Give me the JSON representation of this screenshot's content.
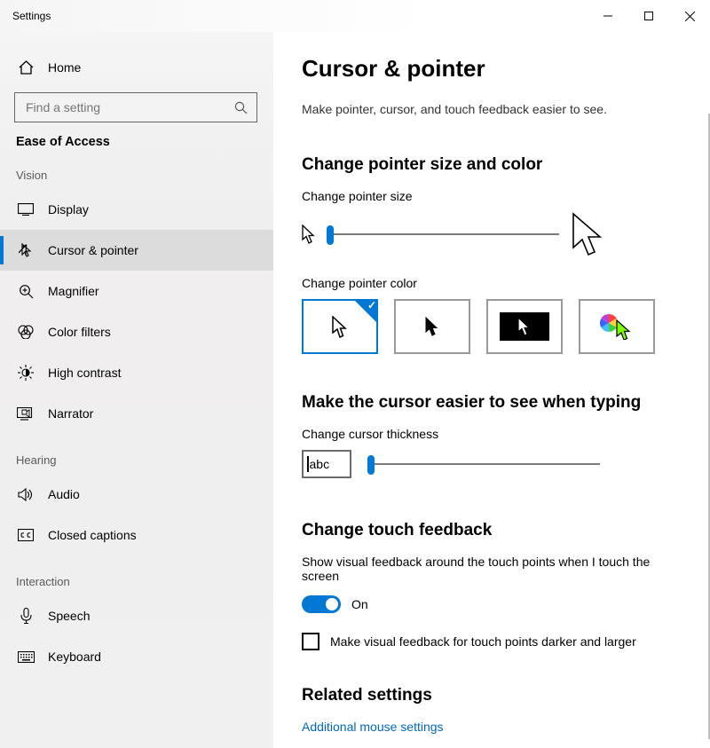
{
  "window": {
    "title": "Settings"
  },
  "sidebar": {
    "home": "Home",
    "search_placeholder": "Find a setting",
    "section": "Ease of Access",
    "groups": [
      {
        "label": "Vision",
        "items": [
          {
            "id": "display",
            "label": "Display"
          },
          {
            "id": "cursor-pointer",
            "label": "Cursor & pointer",
            "selected": true
          },
          {
            "id": "magnifier",
            "label": "Magnifier"
          },
          {
            "id": "color-filters",
            "label": "Color filters"
          },
          {
            "id": "high-contrast",
            "label": "High contrast"
          },
          {
            "id": "narrator",
            "label": "Narrator"
          }
        ]
      },
      {
        "label": "Hearing",
        "items": [
          {
            "id": "audio",
            "label": "Audio"
          },
          {
            "id": "closed-captions",
            "label": "Closed captions"
          }
        ]
      },
      {
        "label": "Interaction",
        "items": [
          {
            "id": "speech",
            "label": "Speech"
          },
          {
            "id": "keyboard",
            "label": "Keyboard"
          }
        ]
      }
    ]
  },
  "page": {
    "title": "Cursor & pointer",
    "subtitle": "Make pointer, cursor, and touch feedback easier to see.",
    "size_section": "Change pointer size and color",
    "size_label": "Change pointer size",
    "color_label": "Change pointer color",
    "cursor_section": "Make the cursor easier to see when typing",
    "thickness_label": "Change cursor thickness",
    "thickness_sample": "abc",
    "touch_section": "Change touch feedback",
    "touch_desc": "Show visual feedback around the touch points when I touch the screen",
    "toggle_state": "On",
    "check_label": "Make visual feedback for touch points darker and larger",
    "related_section": "Related settings",
    "related_link": "Additional mouse settings"
  }
}
